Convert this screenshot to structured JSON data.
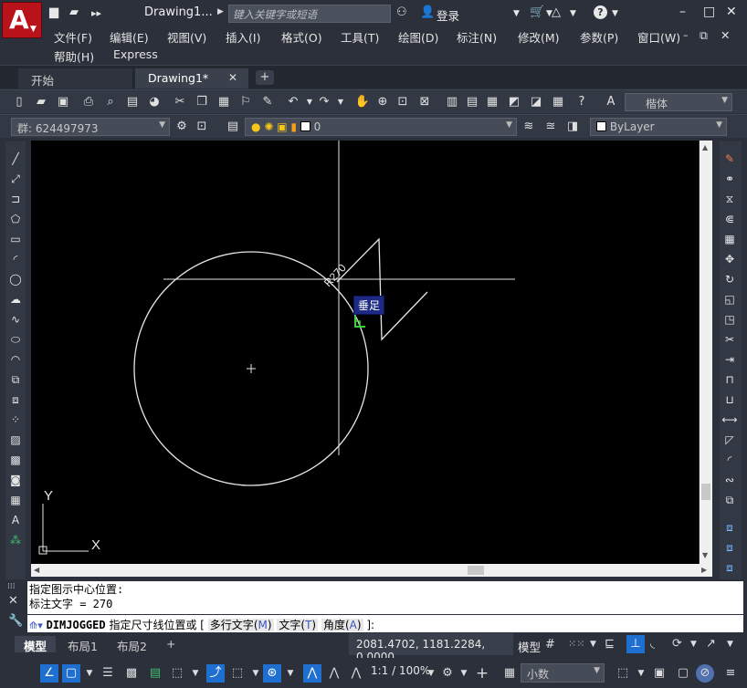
{
  "app": {
    "logo_letter": "A",
    "document_title": "Drawing1...",
    "search_placeholder": "键入关键字或短语",
    "login_label": "登录",
    "window_buttons": {
      "minimize": "–",
      "maximize": "□",
      "close": "✕",
      "restore": "⧉"
    }
  },
  "menus": [
    "文件(F)",
    "编辑(E)",
    "视图(V)",
    "插入(I)",
    "格式(O)",
    "工具(T)",
    "绘图(D)",
    "标注(N)",
    "修改(M)",
    "参数(P)",
    "窗口(W)",
    "帮助(H)",
    "Express"
  ],
  "doc_tabs": {
    "start": "开始",
    "drawing": "Drawing1*",
    "close": "✕",
    "add": "+"
  },
  "toolbar": {
    "text_style": "楷体",
    "group_label": "群: 624497973",
    "layer_name": "0",
    "color_value": "ByLayer"
  },
  "canvas": {
    "dimension_text": "R270",
    "tooltip": "垂足",
    "ucs_y": "Y",
    "ucs_x": "X"
  },
  "command": {
    "history": [
      "指定图示中心位置:",
      "标注文字 = 270"
    ],
    "command_name": "DIMJOGGED",
    "prompt": "指定尺寸线位置或",
    "options": [
      {
        "label": "多行文字",
        "key": "M"
      },
      {
        "label": "文字",
        "key": "T"
      },
      {
        "label": "角度",
        "key": "A"
      }
    ],
    "suffix": "]:"
  },
  "layout_tabs": [
    "模型",
    "布局1",
    "布局2"
  ],
  "layout_add": "+",
  "status": {
    "coordinates": "2081.4702, 1181.2284, 0.0000",
    "model_label": "模型",
    "scale": "1:1 / 100%",
    "units": "小数"
  }
}
